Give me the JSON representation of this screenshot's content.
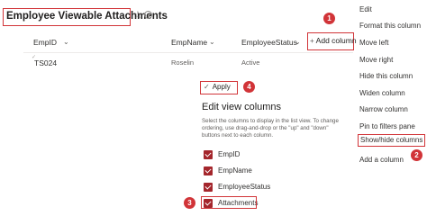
{
  "header": {
    "title": "Employee Viewable Attachments",
    "star_icon": "star-icon",
    "info_icon": "info-icon"
  },
  "columns": {
    "empid": "EmpID",
    "empname": "EmpName",
    "employee_status": "EmployeeStatus",
    "add_column": "Add column"
  },
  "rows": [
    {
      "empid": "TS024",
      "empname": "Roselin",
      "status": "Active"
    }
  ],
  "context_menu": {
    "items": [
      "Edit",
      "Format this column",
      "Move left",
      "Move right",
      "Hide this column",
      "Widen column",
      "Narrow column",
      "Pin to filters pane",
      "Show/hide columns",
      "Add a column"
    ]
  },
  "edit_pane": {
    "apply_label": "Apply",
    "title": "Edit view columns",
    "description": "Select the columns to display in the list view. To change ordering, use drag-and-drop or the \"up\" and \"down\" buttons next to each column.",
    "columns": [
      {
        "label": "EmpID",
        "checked": true
      },
      {
        "label": "EmpName",
        "checked": true
      },
      {
        "label": "EmployeeStatus",
        "checked": true
      },
      {
        "label": "Attachments",
        "checked": true
      }
    ]
  },
  "annotations": [
    "1",
    "2",
    "3",
    "4"
  ],
  "colors": {
    "annotation_red": "#d13438",
    "checkbox_fill": "#a4262c"
  }
}
